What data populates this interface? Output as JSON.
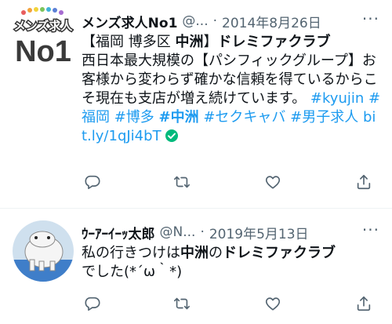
{
  "tweets": [
    {
      "avatar_text": {
        "top": "メンズ求人",
        "bottom": "No1"
      },
      "name": "メンズ求人No1",
      "handle": "@...",
      "dot": "·",
      "date": "2014年8月26日",
      "more": "···",
      "lines": [
        {
          "parts": [
            {
              "t": "【福岡 博多区 "
            },
            {
              "t": "中洲",
              "b": true
            },
            {
              "t": "】"
            },
            {
              "t": "ドレミファクラブ",
              "b": true
            }
          ]
        },
        {
          "parts": [
            {
              "t": "西日本最大規模の【パシフィックグループ】お客様から変わらず確かな信頼を得ているからこそ現在も支店が増え続けています。 "
            },
            {
              "t": " #kyujin #福岡 #博多 ",
              "l": true
            },
            {
              "t": "#中洲",
              "l": true,
              "b": true
            },
            {
              "t": " #セクキャバ #男子求人 bit.ly/1qJi4bT",
              "l": true
            }
          ]
        }
      ]
    },
    {
      "name": "ｳｰｱｰｲｰｯ太郎",
      "handle": "@N...",
      "dot": "·",
      "date": "2019年5月13日",
      "more": "···",
      "lines": [
        {
          "parts": [
            {
              "t": "私の行きつけは"
            },
            {
              "t": "中洲",
              "b": true
            },
            {
              "t": "の"
            },
            {
              "t": "ドレミファクラブ",
              "b": true
            }
          ]
        },
        {
          "parts": [
            {
              "t": "でした(*´ω｀*)"
            }
          ]
        }
      ]
    }
  ],
  "colors": {
    "link": "#1d9bf0",
    "muted": "#536471",
    "text": "#0f1419",
    "verified": "#00ba7c"
  },
  "icons": [
    "reply-icon",
    "retweet-icon",
    "like-icon",
    "share-icon",
    "more-icon",
    "verified-check-icon"
  ]
}
